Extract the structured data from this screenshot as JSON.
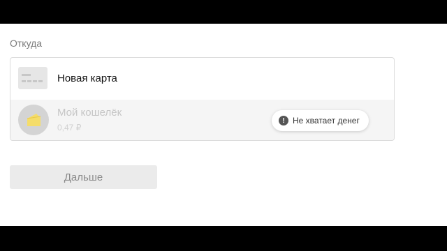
{
  "form": {
    "from_label": "Откуда",
    "sources": [
      {
        "title": "Новая карта",
        "icon": "card-icon",
        "selected": true
      },
      {
        "title": "Мой кошелёк",
        "balance": "0,47 ₽",
        "icon": "wallet-icon",
        "disabled": true
      }
    ],
    "warning": {
      "icon": "exclamation-icon",
      "text": "Не хватает денег"
    },
    "next_label": "Дальше"
  },
  "colors": {
    "wallet_icon_yellow": "#f5dd6a",
    "wallet_icon_circle": "#d4d4d4",
    "disabled_row_bg": "#f5f5f5",
    "button_bg": "#ebebeb"
  }
}
